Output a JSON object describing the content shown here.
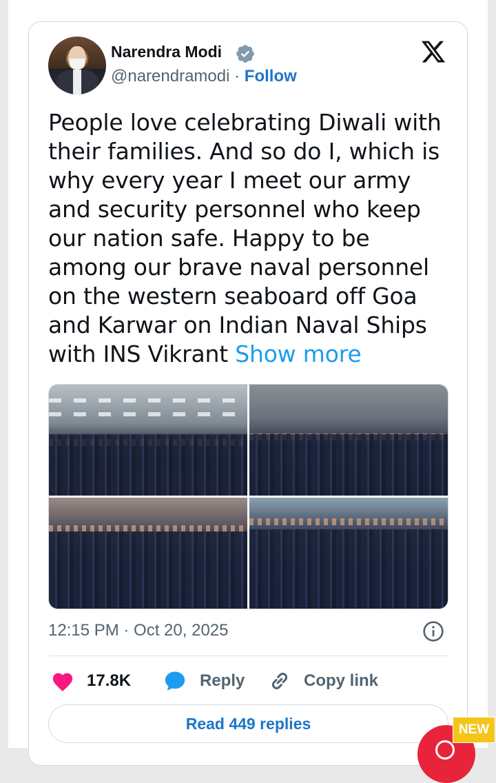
{
  "author": {
    "name": "Narendra Modi",
    "handle": "@narendramodi",
    "separator": "·",
    "follow_label": "Follow"
  },
  "tweet": {
    "text": "People love celebrating Diwali with their families. And so do I, which is why every year I meet our army and security personnel who keep our nation safe. Happy to be among our brave naval personnel on the western seaboard off Goa and Karwar on Indian Naval Ships with INS Vikrant",
    "show_more_label": "Show more",
    "timestamp": "12:15 PM · Oct 20, 2025"
  },
  "actions": {
    "likes": "17.8K",
    "reply_label": "Reply",
    "copy_label": "Copy link",
    "read_replies_label": "Read 449 replies"
  },
  "badge": {
    "new_label": "NEW"
  },
  "icons": {
    "verified": "verified-badge-icon",
    "x": "x-logo-icon",
    "info": "info-icon",
    "like": "heart-icon",
    "reply": "speech-bubble-icon",
    "copy": "link-icon"
  },
  "colors": {
    "accent": "#1d9bf0",
    "like": "#f91880",
    "fab": "#e8243b",
    "badge": "#f5c518"
  }
}
